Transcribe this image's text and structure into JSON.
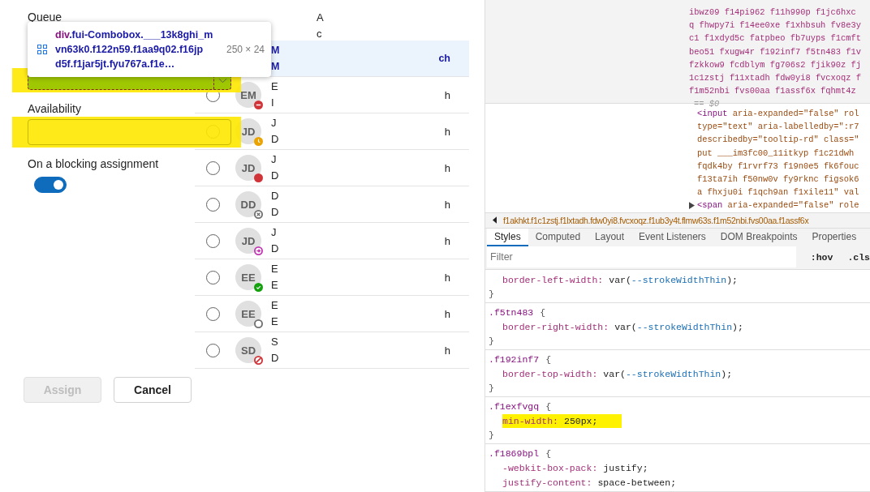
{
  "form": {
    "queue_label": "Queue",
    "queue_field": {
      "highlighted": true
    },
    "availability_label": "Availability",
    "availability_field": {
      "highlighted": true
    },
    "blocking_label": "On a blocking assignment",
    "blocking_toggle": {
      "on": true
    },
    "buttons": [
      {
        "label": "Assign",
        "disabled": true
      },
      {
        "label": "Cancel",
        "disabled": false
      }
    ]
  },
  "inspect_tooltip": {
    "tag": "div",
    "selector_lines": [
      ".fui-Combobox.___13k8ghi_m",
      "vn63k0.f122n59.f1aa9q02.f16jp",
      "d5f.f1jar5jt.fyu767a.f1e…"
    ],
    "size": "250 × 24"
  },
  "list": {
    "header": [
      "A",
      "c"
    ],
    "rows": [
      {
        "line1": "M",
        "line2": "M",
        "trailing": "ch",
        "selected": true
      },
      {
        "initials": "EM",
        "presence": {
          "kind": "dnd",
          "color": "#d13438"
        },
        "line1": "E",
        "line2": "I",
        "trailing": "h",
        "selected": false
      },
      {
        "initials": "JD",
        "presence": {
          "kind": "away",
          "color": "#eaa300"
        },
        "line1": "J",
        "line2": "D",
        "trailing": "h",
        "selected": false
      },
      {
        "initials": "JD",
        "presence": {
          "kind": "busy",
          "color": "#d13438"
        },
        "line1": "J",
        "line2": "D",
        "trailing": "h",
        "selected": false
      },
      {
        "initials": "DD",
        "presence": {
          "kind": "offline",
          "color": "#707070"
        },
        "line1": "D",
        "line2": "D",
        "trailing": "h",
        "selected": false
      },
      {
        "initials": "JD",
        "presence": {
          "kind": "oof",
          "color": "#c239b3"
        },
        "line1": "J",
        "line2": "D",
        "trailing": "h",
        "selected": false
      },
      {
        "initials": "EE",
        "presence": {
          "kind": "available",
          "color": "#13a10e"
        },
        "line1": "E",
        "line2": "E",
        "trailing": "h",
        "selected": false
      },
      {
        "initials": "EE",
        "presence": {
          "kind": "unknown",
          "color": "#707070"
        },
        "line1": "E",
        "line2": "E",
        "trailing": "h",
        "selected": false
      },
      {
        "initials": "SD",
        "presence": {
          "kind": "blocked",
          "color": "#d13438"
        },
        "line1": "S",
        "line2": "D",
        "trailing": "h",
        "selected": false
      }
    ]
  },
  "devtools": {
    "selected_node_lines": [
      "ibwz09 f14pi962 f11h990p f1jc6hxc",
      "q fhwpy7i f14ee0xe f1xhbsuh fv8e3y",
      "c1 f1xdyd5c fatpbeo fb7uyps f1cmft",
      "beo51 fxugw4r f192inf7 f5tn483 f1v",
      "fzkkow9 fcdblym fg706s2 fjik90z fj",
      "1c1zstj f11xtadh fdw0yi8 fvcxoqz f",
      "f1m52nbi fvs00aa f1assf6x fqhmt4z"
    ],
    "node_marker": "== $0",
    "dom_lines": [
      {
        "tag": "<input",
        "text": " aria-expanded=\"false\" rol",
        "expandable": false
      },
      {
        "text": "type=\"text\" aria-labelledby=\":r7",
        "expandable": false
      },
      {
        "text": "describedby=\"tooltip-rd\" class=\"",
        "expandable": false
      },
      {
        "text": "put ___im3fc00_11itkyp f1c21dwh",
        "expandable": false
      },
      {
        "text": "fqdk4by f1rvrf73 f19n0e5 fk6fouc",
        "expandable": false
      },
      {
        "text": "f13ta7ih f50nw0v fy9rknc figsok6",
        "expandable": false
      },
      {
        "text": "a fhxju0i f1qch9an f1xile11\" val",
        "expandable": false
      },
      {
        "tag": "<span",
        "text": " aria-expanded=\"false\" role",
        "expandable": true
      }
    ],
    "breadcrumb": "f1akhkt.f1c1zstj.f1lxtadh.fdw0yi8.fvcxoqz.f1ub3y4t.flmw63s.f1m52nbi.fvs00aa.f1assf6x",
    "tabs": [
      {
        "label": "Styles",
        "selected": true
      },
      {
        "label": "Computed",
        "selected": false
      },
      {
        "label": "Layout",
        "selected": false
      },
      {
        "label": "Event Listeners",
        "selected": false
      },
      {
        "label": "DOM Breakpoints",
        "selected": false
      },
      {
        "label": "Properties",
        "selected": false
      }
    ],
    "filter_placeholder": "Filter",
    "filter_buttons": [
      ":hov",
      ".cls"
    ],
    "rules": [
      {
        "declarations": [
          {
            "property": "border-left-width:",
            "value_parts": [
              {
                "text": "var(",
                "kind": "plain"
              },
              {
                "text": "--strokeWidthThin",
                "kind": "var"
              },
              {
                "text": ");",
                "kind": "plain"
              }
            ],
            "highlighted": false
          }
        ],
        "close": "}"
      },
      {
        "selector": ".f5tn483",
        "open": "{",
        "declarations": [
          {
            "property": "border-right-width:",
            "value_parts": [
              {
                "text": "var(",
                "kind": "plain"
              },
              {
                "text": "--strokeWidthThin",
                "kind": "var"
              },
              {
                "text": ");",
                "kind": "plain"
              }
            ],
            "highlighted": false
          }
        ],
        "close": "}"
      },
      {
        "selector": ".f192inf7",
        "open": "{",
        "declarations": [
          {
            "property": "border-top-width:",
            "value_parts": [
              {
                "text": "var(",
                "kind": "plain"
              },
              {
                "text": "--strokeWidthThin",
                "kind": "var"
              },
              {
                "text": ");",
                "kind": "plain"
              }
            ],
            "highlighted": false
          }
        ],
        "close": "}"
      },
      {
        "selector": ".f1exfvgq",
        "open": "{",
        "declarations": [
          {
            "property": "min-width:",
            "value_parts": [
              {
                "text": "250px;",
                "kind": "plain"
              }
            ],
            "highlighted": true
          }
        ],
        "close": "}"
      },
      {
        "selector": ".f1869bpl",
        "open": "{",
        "declarations": [
          {
            "property": "-webkit-box-pack:",
            "value_parts": [
              {
                "text": "justify;",
                "kind": "plain"
              }
            ],
            "highlighted": false
          },
          {
            "property": "justify-content:",
            "value_parts": [
              {
                "text": "space-between;",
                "kind": "plain"
              }
            ],
            "highlighted": false
          }
        ]
      }
    ]
  }
}
